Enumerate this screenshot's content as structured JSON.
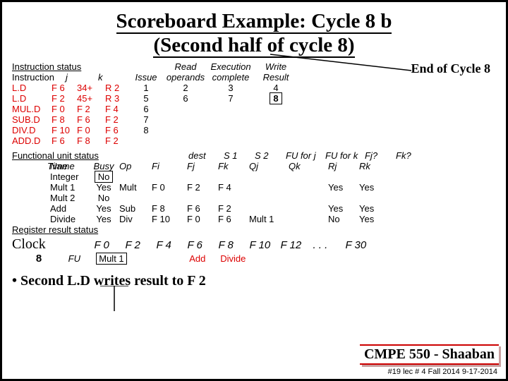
{
  "title_line1": "Scoreboard Example:  Cycle 8 b",
  "title_line2": "(Second half of cycle 8)",
  "end_of_cycle": "End of Cycle 8",
  "sections": {
    "instruction_status": "Instruction status",
    "functional_unit_status": "Functional unit status",
    "register_result_status": "Register result status"
  },
  "ihdr": {
    "instruction": "Instruction",
    "j": "j",
    "k": "k",
    "issue": "Issue",
    "read": "Read",
    "operands": "operands",
    "exec": "Execution",
    "complete": "complete",
    "write": "Write",
    "result": "Result"
  },
  "instr": [
    {
      "op": "L.D",
      "d": "F 6",
      "j": "34+",
      "k": "R 2",
      "issue": "1",
      "read": "2",
      "exec": "3",
      "write": "4",
      "hl": false
    },
    {
      "op": "L.D",
      "d": "F 2",
      "j": "45+",
      "k": "R 3",
      "issue": "5",
      "read": "6",
      "exec": "7",
      "write": "8",
      "hl": true
    },
    {
      "op": "MUL.D",
      "d": "F 0",
      "j": "F 2",
      "k": "F 4",
      "issue": "6",
      "read": "",
      "exec": "",
      "write": "",
      "hl": false
    },
    {
      "op": "SUB.D",
      "d": "F 8",
      "j": "F 6",
      "k": "F 2",
      "issue": "7",
      "read": "",
      "exec": "",
      "write": "",
      "hl": false
    },
    {
      "op": "DIV.D",
      "d": "F 10",
      "j": "F 0",
      "k": "F 6",
      "issue": "8",
      "read": "",
      "exec": "",
      "write": "",
      "hl": false
    },
    {
      "op": "ADD.D",
      "d": "F 6",
      "j": "F 8",
      "k": "F 2",
      "issue": "",
      "read": "",
      "exec": "",
      "write": "",
      "hl": false
    }
  ],
  "fhdr": {
    "time": "Time",
    "name": "Name",
    "busy": "Busy",
    "op": "Op",
    "dest": "dest",
    "fi": "Fi",
    "s1": "S 1",
    "fj": "Fj",
    "s2": "S 2",
    "fk": "Fk",
    "fu_j": "FU for j",
    "qj": "Qj",
    "fu_k": "FU for k",
    "qk": "Qk",
    "fjq": "Fj?",
    "rj": "Rj",
    "fkq": "Fk?",
    "rk": "Rk"
  },
  "fu": [
    {
      "name": "Integer",
      "busy": "No",
      "op": "",
      "fi": "",
      "fj": "",
      "fk": "",
      "qj": "",
      "qk": "",
      "rj": "",
      "rk": "",
      "busybox": true
    },
    {
      "name": "Mult 1",
      "busy": "Yes",
      "op": "Mult",
      "fi": "F 0",
      "fj": "F 2",
      "fk": "F 4",
      "qj": "",
      "qk": "",
      "rj": "Yes",
      "rk": "Yes"
    },
    {
      "name": "Mult 2",
      "busy": "No",
      "op": "",
      "fi": "",
      "fj": "",
      "fk": "",
      "qj": "",
      "qk": "",
      "rj": "",
      "rk": ""
    },
    {
      "name": "Add",
      "busy": "Yes",
      "op": "Sub",
      "fi": "F 8",
      "fj": "F 6",
      "fk": "F 2",
      "qj": "",
      "qk": "",
      "rj": "Yes",
      "rk": "Yes"
    },
    {
      "name": "Divide",
      "busy": "Yes",
      "op": "Div",
      "fi": "F 10",
      "fj": "F 0",
      "fk": "F 6",
      "qj": "Mult 1",
      "qk": "",
      "rj": "No",
      "rk": "Yes"
    }
  ],
  "clock_label": "Clock",
  "regs": [
    "F 0",
    "F 2",
    "F 4",
    "F 6",
    "F 8",
    "F 10",
    "F 12",
    ". . .",
    "F 30"
  ],
  "cycle": "8",
  "fu_label": "FU",
  "regvals": [
    "Mult 1",
    "",
    "",
    "Add",
    "Divide",
    "",
    "",
    "",
    ""
  ],
  "bullet": "• Second L.D writes result to F 2",
  "footer": "CMPE 550 - Shaaban",
  "subfoot": "#19  lec # 4 Fall 2014   9-17-2014"
}
